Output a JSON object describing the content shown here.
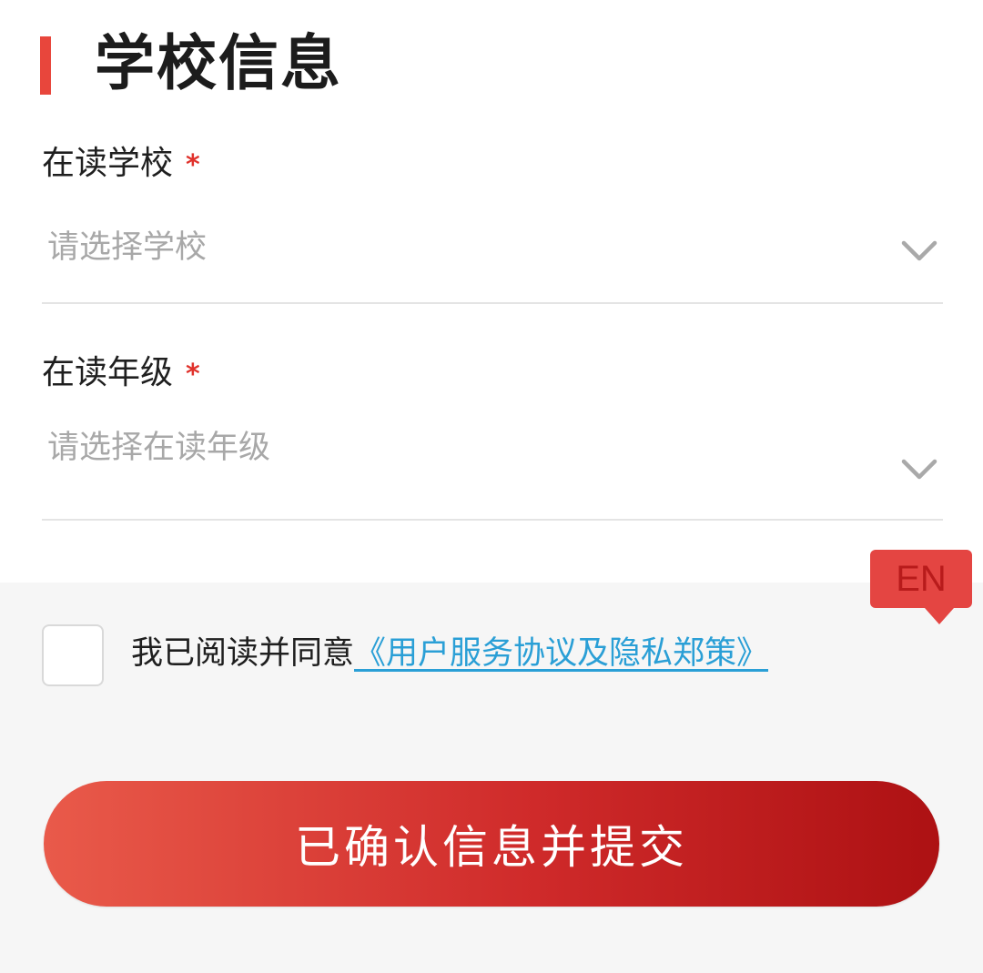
{
  "section": {
    "title": "学校信息"
  },
  "fields": [
    {
      "label": "在读学校",
      "required_mark": "*",
      "placeholder": "请选择学校",
      "icon": "chevron-down-icon"
    },
    {
      "label": "在读年级",
      "required_mark": "*",
      "placeholder": "请选择在读年级",
      "icon": "chevron-down-icon"
    }
  ],
  "agreement": {
    "prefix": "我已阅读并同意",
    "link": "《用户服务协议及隐私郑策》",
    "checked": false
  },
  "language_badge": {
    "label": "EN"
  },
  "submit": {
    "label": "已确认信息并提交"
  },
  "colors": {
    "accent": "#e8463c",
    "required": "#e0322c",
    "link": "#2a9fd6",
    "button_start": "#e95a4a",
    "button_end": "#ad1113"
  }
}
